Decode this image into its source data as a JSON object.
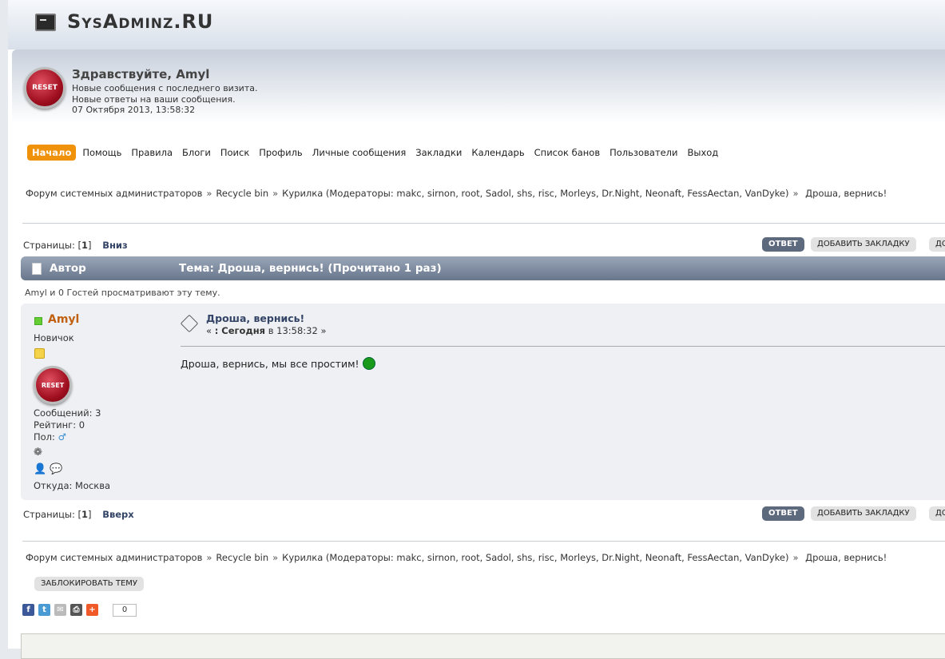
{
  "site": {
    "name": "SysAdminz.RU"
  },
  "user": {
    "avatar_label": "RESET",
    "greeting": "Здравствуйте, Amyl",
    "new_messages": "Новые сообщения с последнего визита.",
    "new_replies": "Новые ответы на ваши сообщения.",
    "datetime": "07 Октября 2013, 13:58:32"
  },
  "menu": [
    "Начало",
    "Помощь",
    "Правила",
    "Блоги",
    "Поиск",
    "Профиль",
    "Личные сообщения",
    "Закладки",
    "Календарь",
    "Список банов",
    "Пользователи",
    "Выход"
  ],
  "breadcrumb": {
    "forum": "Форум системных администраторов",
    "section": "Recycle bin",
    "board": "Курилка (Модераторы: makc, sirnon, root, Sadol, shs, risc, Morleys, Dr.Night, Neonaft, FessAectan, VanDyke)",
    "topic": "Дроша, вернись!",
    "sep": "»"
  },
  "pages": {
    "label": "Страницы:",
    "current": "1",
    "down": "Вниз",
    "up": "Вверх"
  },
  "buttons": {
    "reply": "ОТВЕТ",
    "bookmark": "ДОБАВИТЬ ЗАКЛАДКУ",
    "more": "ДО",
    "lock": "ЗАБЛОКИРОВАТЬ ТЕМУ"
  },
  "header": {
    "author": "Автор",
    "topic": "Тема: Дроша, вернись!  (Прочитано 1 раз)"
  },
  "viewers": "Amyl и 0 Гостей просматривают эту тему.",
  "post": {
    "author": "Amyl",
    "rank": "Новичок",
    "avatar_label": "RESET",
    "messages": "Сообщений: 3",
    "rating": "Рейтинг: 0",
    "gender_label": "Пол:",
    "gender_icon": "♂",
    "location": "Откуда: Москва",
    "subject": "Дроша, вернись!",
    "date_prefix": "« ",
    "date_today": ": Сегодня",
    "date_rest": " в 13:58:32 »",
    "body": "Дроша, вернись, мы все простим!"
  },
  "share": {
    "count": "0",
    "colors": {
      "facebook": "#3b5998",
      "twitter": "#4a9ad4",
      "email": "#bbbbbb",
      "print": "#555555",
      "plus": "#f05a28"
    }
  }
}
